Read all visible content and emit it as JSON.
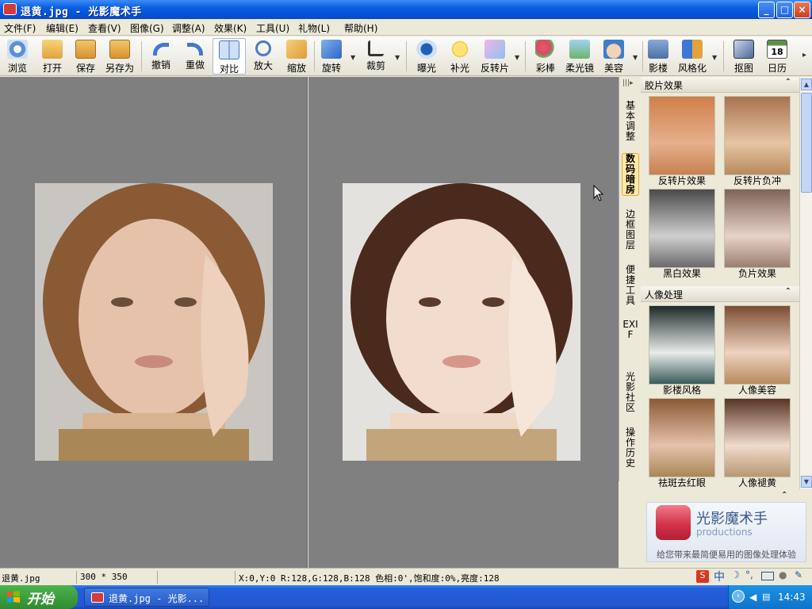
{
  "window": {
    "title": "退黄.jpg - 光影魔术手",
    "min": "_",
    "max": "□",
    "close": "×"
  },
  "menu": [
    {
      "label": "文件(F)"
    },
    {
      "label": "编辑(E)"
    },
    {
      "label": "查看(V)"
    },
    {
      "label": "图像(G)"
    },
    {
      "label": "调整(A)"
    },
    {
      "label": "效果(K)"
    },
    {
      "label": "工具(U)"
    },
    {
      "label": "礼物(L)"
    },
    {
      "label": "帮助(H)"
    }
  ],
  "toolbar": [
    {
      "label": "浏览",
      "icon": "browse-icon",
      "color": "#5b8fd6"
    },
    {
      "label": "打开",
      "icon": "open-folder-icon",
      "color": "#e9b54a"
    },
    {
      "label": "保存",
      "icon": "save-icon",
      "color": "#e2a23b"
    },
    {
      "label": "另存为",
      "icon": "save-as-icon",
      "color": "#e2a23b"
    },
    {
      "label": "撤销",
      "icon": "undo-icon",
      "color": "#3f78d4"
    },
    {
      "label": "重做",
      "icon": "redo-icon",
      "color": "#3f78d4"
    },
    {
      "label": "对比",
      "icon": "compare-icon",
      "color": "#7aa5d8"
    },
    {
      "label": "放大",
      "icon": "zoom-in-icon",
      "color": "#4b7cc8"
    },
    {
      "label": "缩放",
      "icon": "resize-icon",
      "color": "#e3a23c"
    },
    {
      "label": "旋转",
      "icon": "rotate-icon",
      "color": "#3c77d3"
    },
    {
      "label": "裁剪",
      "icon": "crop-icon",
      "color": "#333333"
    },
    {
      "label": "曝光",
      "icon": "exposure-icon",
      "color": "#1f5fb8"
    },
    {
      "label": "补光",
      "icon": "fill-light-icon",
      "color": "#f0c23a"
    },
    {
      "label": "反转片",
      "icon": "reversal-film-icon",
      "color": "#d98bd1"
    },
    {
      "label": "彩棒",
      "icon": "color-wand-icon",
      "color": "#d84a6a"
    },
    {
      "label": "柔光镜",
      "icon": "soft-focus-icon",
      "color": "#6fb36a"
    },
    {
      "label": "美容",
      "icon": "beauty-icon",
      "color": "#3e7ec8"
    },
    {
      "label": "影楼",
      "icon": "studio-icon",
      "color": "#4b6fa8"
    },
    {
      "label": "风格化",
      "icon": "stylize-icon",
      "color": "#e3a23c"
    },
    {
      "label": "抠图",
      "icon": "cutout-icon",
      "color": "#4a6a9a"
    },
    {
      "label": "日历",
      "icon": "calendar-icon",
      "color": "#5c8f4a",
      "badge": "18"
    }
  ],
  "side_tabs": [
    {
      "label": "基本调整"
    },
    {
      "label": "数码暗房"
    },
    {
      "label": "边框图层"
    },
    {
      "label": "便捷工具"
    },
    {
      "label": "EXIF"
    },
    {
      "label": "光影社区"
    },
    {
      "label": "操作历史"
    }
  ],
  "panel": {
    "section1": {
      "title": "胶片效果",
      "items": [
        {
          "label": "反转片效果"
        },
        {
          "label": "反转片负冲"
        },
        {
          "label": "黑白效果"
        },
        {
          "label": "负片效果"
        }
      ]
    },
    "section2": {
      "title": "人像处理",
      "items": [
        {
          "label": "影楼风格"
        },
        {
          "label": "人像美容"
        },
        {
          "label": "祛斑去红眼"
        },
        {
          "label": "人像褪黄"
        }
      ]
    }
  },
  "promo": {
    "brand": "光影魔术手",
    "sub": "productions",
    "tagline": "给您带来最简便易用的图像处理体验"
  },
  "status": {
    "file": "退黄.jpg",
    "size": "300 * 350",
    "info": "X:0,Y:0 R:128,G:128,B:128 色相:0',饱和度:0%,亮度:128"
  },
  "taskbar": {
    "start": "开始",
    "task": "退黄.jpg - 光影...",
    "clock": "14:43"
  }
}
